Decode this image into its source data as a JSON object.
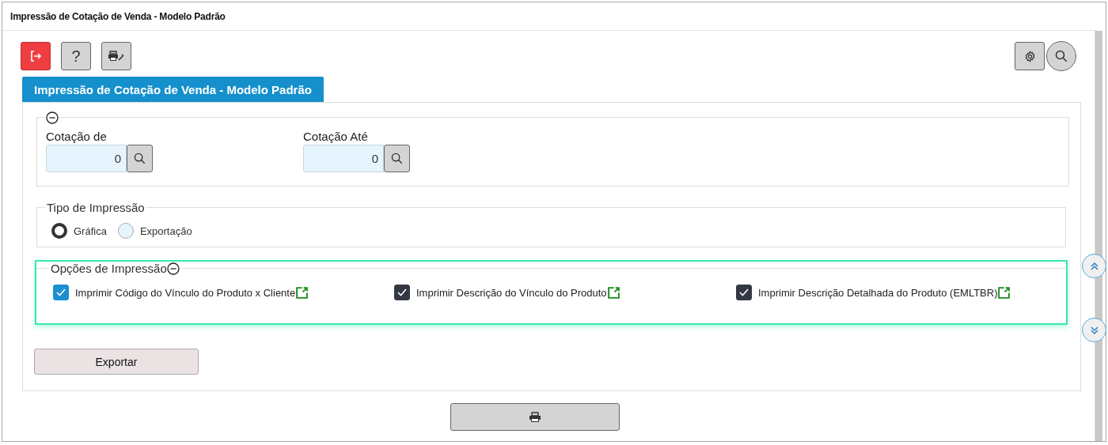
{
  "window": {
    "title": "Impressão de Cotação de Venda - Modelo Padrão"
  },
  "toolbar": {
    "left": [
      {
        "kind": "exit"
      },
      {
        "kind": "help",
        "label": "?"
      },
      {
        "kind": "print-setup"
      }
    ],
    "right": [
      {
        "kind": "settings"
      },
      {
        "kind": "search"
      }
    ]
  },
  "tab": {
    "label": "Impressão de Cotação de Venda - Modelo Padrão"
  },
  "range": {
    "fields": [
      {
        "label": "Cotação de",
        "value": "0"
      },
      {
        "label": "Cotação Até",
        "value": "0"
      }
    ]
  },
  "print_type": {
    "legend": "Tipo de Impressão",
    "options": [
      {
        "label": "Gráfica",
        "selected": true
      },
      {
        "label": "Exportação",
        "selected": false
      }
    ]
  },
  "print_options": {
    "legend": "Opções de Impressão",
    "items": [
      {
        "label": "Imprimir Código do Vínculo do Produto x Cliente",
        "checked": true,
        "color": "#1b8fd0"
      },
      {
        "label": "Imprimir Descrição do Vínculo do Produto",
        "checked": true,
        "color": "#333842"
      },
      {
        "label": "Imprimir Descrição Detalhada do Produto (EMLTBR)",
        "checked": true,
        "color": "#333842"
      }
    ]
  },
  "export_button": {
    "label": "Exportar"
  }
}
